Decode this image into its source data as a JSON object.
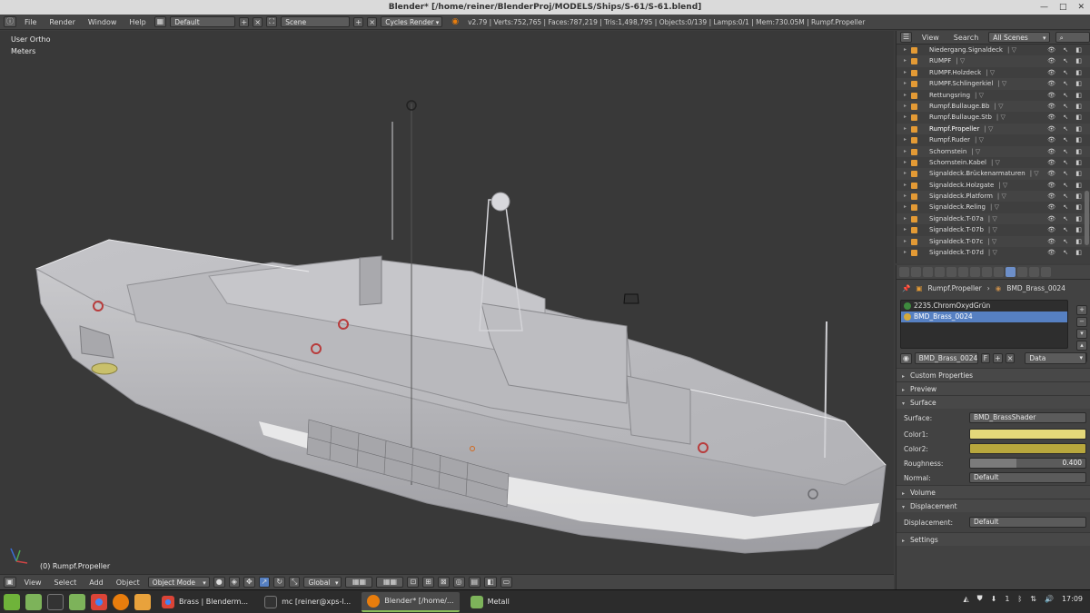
{
  "window": {
    "title": "Blender* [/home/reiner/BlenderProj/MODELS/Ships/S-61/S-61.blend]"
  },
  "header": {
    "menus": [
      "File",
      "Render",
      "Window",
      "Help"
    ],
    "layout": "Default",
    "scene": "Scene",
    "engine": "Cycles Render",
    "stats": "v2.79 | Verts:752,765 | Faces:787,219 | Tris:1,498,795 | Objects:0/139 | Lamps:0/1 | Mem:730.05M | Rumpf.Propeller"
  },
  "viewport": {
    "view_name": "User Ortho",
    "units": "Meters",
    "active_object": "(0) Rumpf.Propeller"
  },
  "viewport_footer": {
    "menus": [
      "View",
      "Select",
      "Add",
      "Object"
    ],
    "mode": "Object Mode",
    "orientation": "Global"
  },
  "outliner": {
    "menus": [
      "View",
      "Search"
    ],
    "display": "All Scenes",
    "rows": [
      {
        "name": "Niedergang.Signaldeck"
      },
      {
        "name": "RUMPF"
      },
      {
        "name": "RUMPF.Holzdeck"
      },
      {
        "name": "RUMPF.Schlingerkiel"
      },
      {
        "name": "Rettungsring"
      },
      {
        "name": "Rumpf.Bullauge.Bb"
      },
      {
        "name": "Rumpf.Bullauge.Stb"
      },
      {
        "name": "Rumpf.Propeller"
      },
      {
        "name": "Rumpf.Ruder"
      },
      {
        "name": "Schornstein"
      },
      {
        "name": "Schornstein.Kabel"
      },
      {
        "name": "Signaldeck.Brückenarmaturen"
      },
      {
        "name": "Signaldeck.Holzgate"
      },
      {
        "name": "Signaldeck.Platform"
      },
      {
        "name": "Signaldeck.Reling"
      },
      {
        "name": "Signaldeck.T-07a"
      },
      {
        "name": "Signaldeck.T-07b"
      },
      {
        "name": "Signaldeck.T-07c"
      },
      {
        "name": "Signaldeck.T-07d"
      }
    ]
  },
  "properties": {
    "breadcrumb_object": "Rumpf.Propeller",
    "breadcrumb_material": "BMD_Brass_0024",
    "material_slots": [
      {
        "name": "2235.ChromOxydGrün",
        "color": "#3e8a3e"
      },
      {
        "name": "BMD_Brass_0024",
        "color": "#d4a93a"
      }
    ],
    "material_name": "BMD_Brass_0024",
    "fake_user": "F",
    "link": "Data",
    "panels": {
      "custom_properties": "Custom Properties",
      "preview": "Preview",
      "surface": "Surface",
      "volume": "Volume",
      "displacement": "Displacement",
      "settings": "Settings"
    },
    "surface_label": "Surface:",
    "surface_shader": "BMD_BrassShader",
    "color1_label": "Color1:",
    "color2_label": "Color2:",
    "roughness_label": "Roughness:",
    "roughness": "0.400",
    "normal_label": "Normal:",
    "normal": "Default",
    "displacement_label": "Displacement:",
    "displacement": "Default",
    "color1": "#e4d87a",
    "color2": "#b8a73d"
  },
  "taskbar": {
    "tasks": [
      {
        "label": "Brass | Blenderm...",
        "icon": "chrome-icon"
      },
      {
        "label": "mc [reiner@xps-l...",
        "icon": "terminal-icon"
      },
      {
        "label": "Blender* [/home/...",
        "icon": "blender-icon"
      },
      {
        "label": "Metall",
        "icon": "folder-icon"
      }
    ],
    "tray_count": "1",
    "clock": "17:09"
  }
}
